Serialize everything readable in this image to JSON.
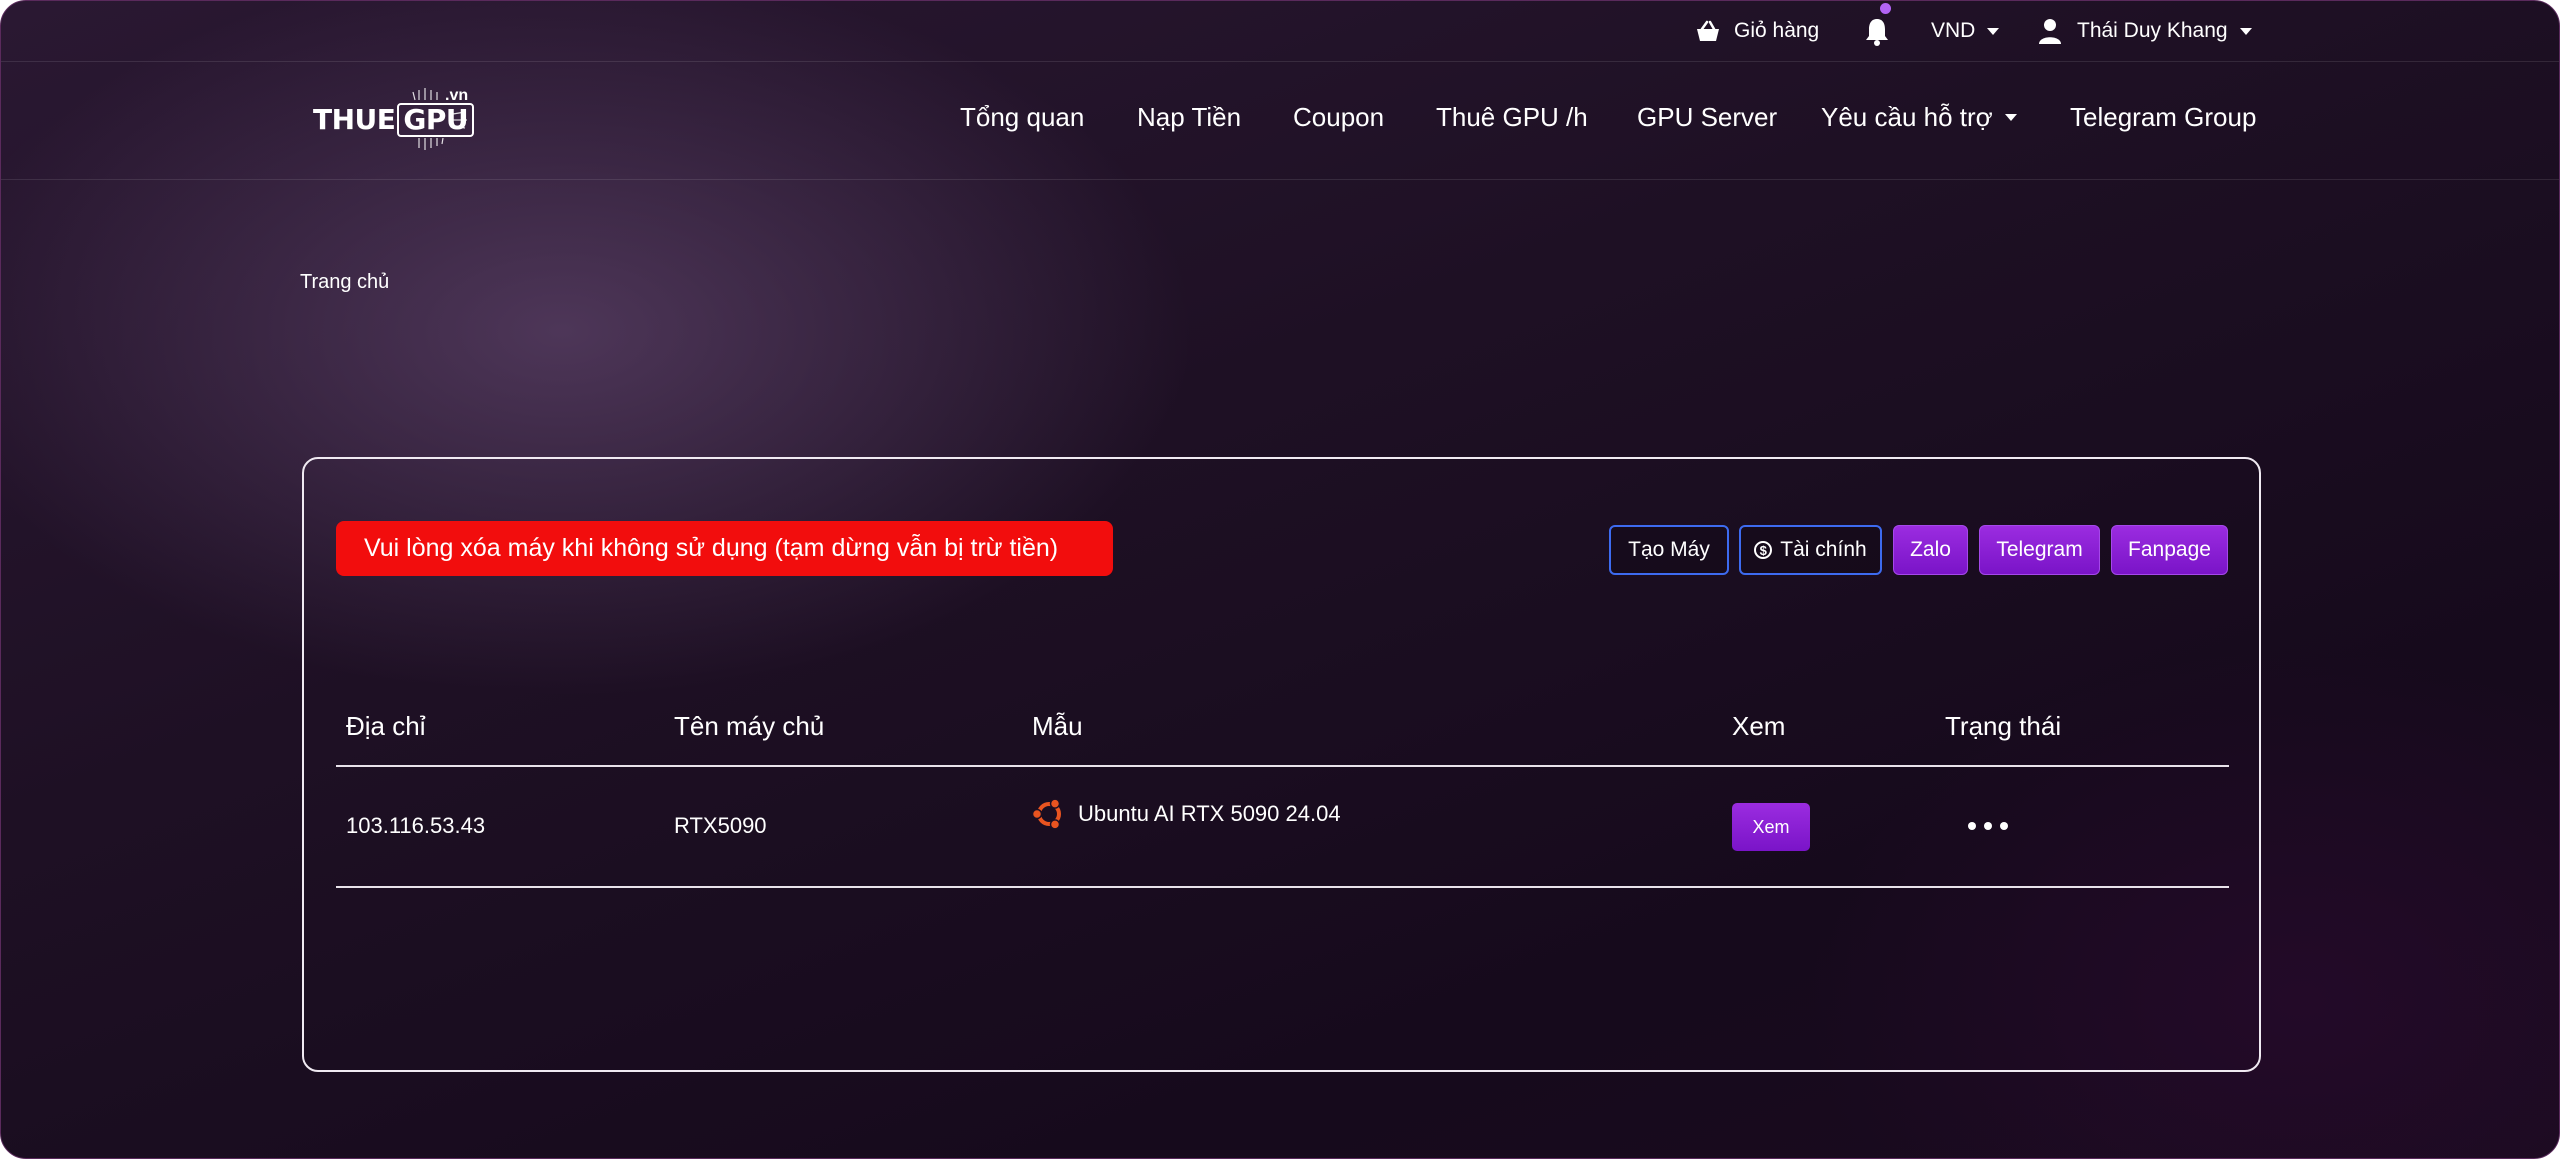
{
  "topbar": {
    "cart_label": "Giỏ hàng",
    "currency_label": "VND",
    "user_name": "Thái Duy Khang"
  },
  "logo": {
    "text_main": "THUE",
    "text_boxed": "GPU",
    "text_suffix": ".vn"
  },
  "nav": {
    "items": [
      {
        "label": "Tổng quan"
      },
      {
        "label": "Nạp Tiền"
      },
      {
        "label": "Coupon"
      },
      {
        "label": "Thuê GPU /h"
      },
      {
        "label": "GPU Server"
      },
      {
        "label": "Yêu cầu hỗ trợ"
      },
      {
        "label": "Telegram Group"
      }
    ]
  },
  "breadcrumb": {
    "home": "Trang chủ"
  },
  "card": {
    "alert_text": "Vui lòng xóa máy khi không sử dụng (tạm dừng vẫn bị trừ tiền)",
    "buttons": {
      "create": "Tạo Máy",
      "finance": "Tài chính",
      "zalo": "Zalo",
      "telegram": "Telegram",
      "fanpage": "Fanpage"
    },
    "table": {
      "headers": [
        "Địa chỉ",
        "Tên máy chủ",
        "Mẫu",
        "Xem",
        "Trạng thái"
      ],
      "rows": [
        {
          "address": "103.116.53.43",
          "hostname": "RTX5090",
          "template": "Ubuntu AI RTX 5090 24.04",
          "view_label": "Xem"
        }
      ]
    }
  },
  "colors": {
    "alert": "#f20d0d",
    "accent_purple": "#8a1fd6",
    "outline_blue": "#3d6bf0",
    "ubuntu_orange": "#e95420"
  },
  "icons": {
    "cart": "basket-icon",
    "bell": "bell-icon",
    "user": "user-icon",
    "finance": "dollar-circle-icon",
    "template": "ubuntu-icon",
    "status": "more-dots-icon"
  }
}
